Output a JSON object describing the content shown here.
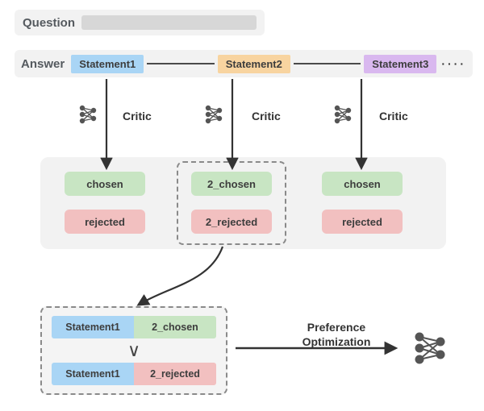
{
  "question": {
    "label": "Question"
  },
  "answer": {
    "label": "Answer",
    "statements": [
      "Statement1",
      "Statement2",
      "Statement3"
    ],
    "ellipsis": "····"
  },
  "critic": {
    "label": "Critic"
  },
  "outcomes": {
    "col1": {
      "chosen": "chosen",
      "rejected": "rejected"
    },
    "col2": {
      "chosen": "2_chosen",
      "rejected": "2_rejected"
    },
    "col3": {
      "chosen": "chosen",
      "rejected": "rejected"
    }
  },
  "bottom": {
    "pair1": {
      "left": "Statement1",
      "right": "2_chosen"
    },
    "symbol": "∨",
    "pair2": {
      "left": "Statement1",
      "right": "2_rejected"
    }
  },
  "po": {
    "line1": "Preference",
    "line2": "Optimization"
  },
  "colors": {
    "stmt1": "#a9d5f5",
    "stmt2": "#f8d4a0",
    "stmt3": "#d9b8ef",
    "chosen": "#c8e5c3",
    "rejected": "#f2c0c0"
  }
}
